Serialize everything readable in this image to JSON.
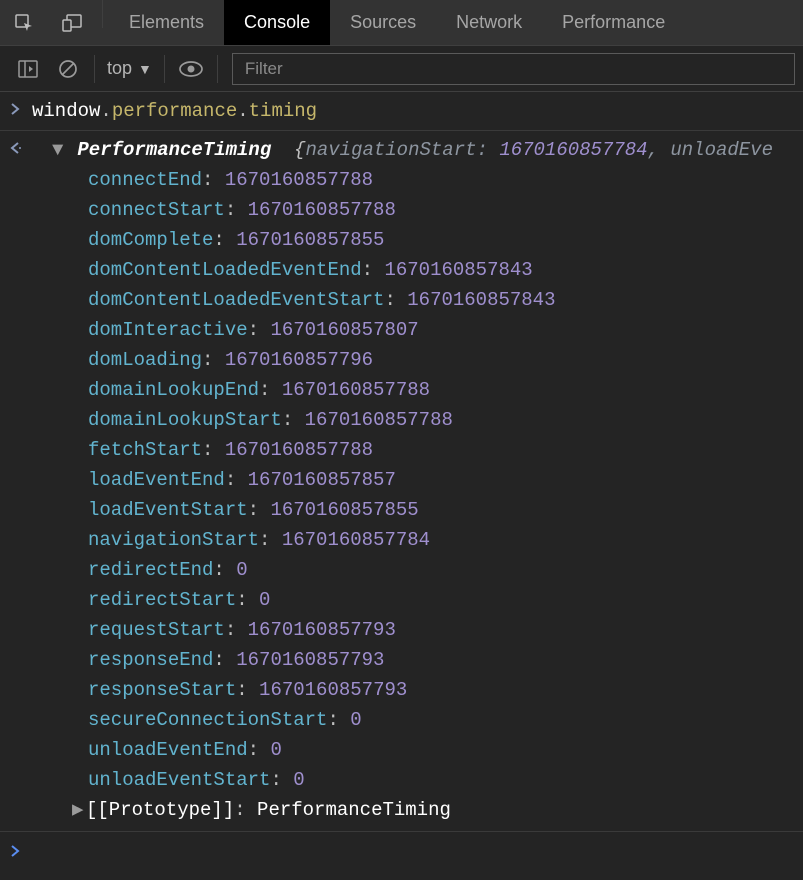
{
  "tabs": {
    "elements": "Elements",
    "console": "Console",
    "sources": "Sources",
    "network": "Network",
    "performance": "Performance"
  },
  "toolbar": {
    "context_label": "top",
    "filter_placeholder": "Filter"
  },
  "input": {
    "obj1": "window",
    "dot1": ".",
    "prop1": "performance",
    "dot2": ".",
    "prop2": "timing"
  },
  "output": {
    "type_name": "PerformanceTiming",
    "open_brace": "{",
    "preview_key": "navigationStart",
    "preview_colon": ":",
    "preview_val": "1670160857784",
    "preview_sep": ", ",
    "preview_trail": "unloadEve"
  },
  "timing": {
    "connectEnd": "1670160857788",
    "connectStart": "1670160857788",
    "domComplete": "1670160857855",
    "domContentLoadedEventEnd": "1670160857843",
    "domContentLoadedEventStart": "1670160857843",
    "domInteractive": "1670160857807",
    "domLoading": "1670160857796",
    "domainLookupEnd": "1670160857788",
    "domainLookupStart": "1670160857788",
    "fetchStart": "1670160857788",
    "loadEventEnd": "1670160857857",
    "loadEventStart": "1670160857855",
    "navigationStart": "1670160857784",
    "redirectEnd": "0",
    "redirectStart": "0",
    "requestStart": "1670160857793",
    "responseEnd": "1670160857793",
    "responseStart": "1670160857793",
    "secureConnectionStart": "0",
    "unloadEventEnd": "0",
    "unloadEventStart": "0"
  },
  "proto": {
    "label": "[[Prototype]]",
    "value": "PerformanceTiming"
  },
  "timing_keys": [
    "connectEnd",
    "connectStart",
    "domComplete",
    "domContentLoadedEventEnd",
    "domContentLoadedEventStart",
    "domInteractive",
    "domLoading",
    "domainLookupEnd",
    "domainLookupStart",
    "fetchStart",
    "loadEventEnd",
    "loadEventStart",
    "navigationStart",
    "redirectEnd",
    "redirectStart",
    "requestStart",
    "responseEnd",
    "responseStart",
    "secureConnectionStart",
    "unloadEventEnd",
    "unloadEventStart"
  ]
}
